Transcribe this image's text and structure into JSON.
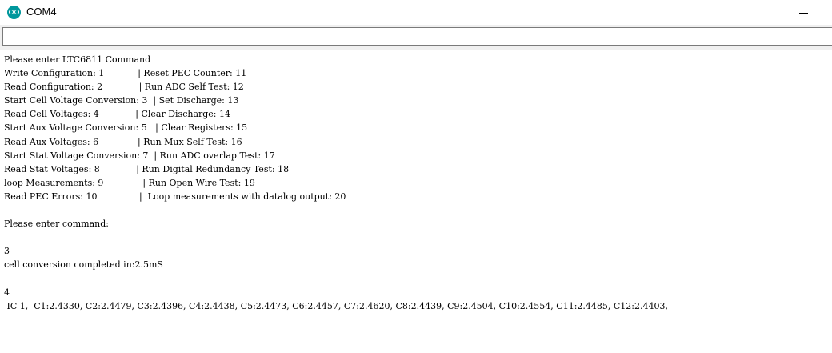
{
  "window": {
    "title": "COM4"
  },
  "input": {
    "value": ""
  },
  "output": {
    "lines": [
      "Please enter LTC6811 Command",
      "Write Configuration: 1            | Reset PEC Counter: 11",
      "Read Configuration: 2             | Run ADC Self Test: 12",
      "Start Cell Voltage Conversion: 3  | Set Discharge: 13",
      "Read Cell Voltages: 4             | Clear Discharge: 14",
      "Start Aux Voltage Conversion: 5   | Clear Registers: 15",
      "Read Aux Voltages: 6              | Run Mux Self Test: 16",
      "Start Stat Voltage Conversion: 7  | Run ADC overlap Test: 17",
      "Read Stat Voltages: 8             | Run Digital Redundancy Test: 18",
      "loop Measurements: 9              | Run Open Wire Test: 19",
      "Read PEC Errors: 10               |  Loop measurements with datalog output: 20",
      "",
      "Please enter command:",
      "",
      "3",
      "cell conversion completed in:2.5mS",
      "",
      "4",
      " IC 1,  C1:2.4330, C2:2.4479, C3:2.4396, C4:2.4438, C5:2.4473, C6:2.4457, C7:2.4620, C8:2.4439, C9:2.4504, C10:2.4554, C11:2.4485, C12:2.4403,"
    ]
  }
}
